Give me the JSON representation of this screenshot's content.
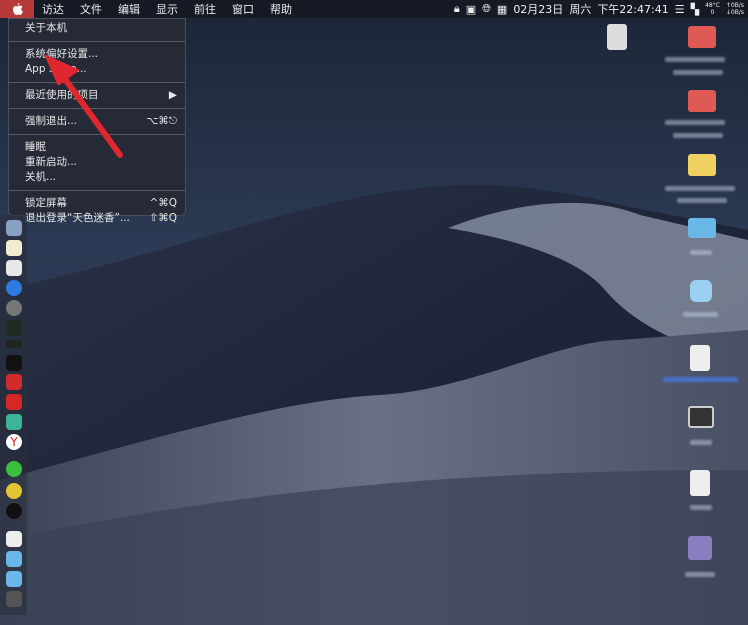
{
  "menubar": {
    "apple": "",
    "items": [
      "访达",
      "文件",
      "编辑",
      "显示",
      "前往",
      "窗口",
      "帮助"
    ],
    "status": {
      "date": "02月23日",
      "weekday": "周六",
      "time": "下午22:47:41",
      "temp": "48°C",
      "temp_sub": "0",
      "net_up": "↑0B/s",
      "net_down": "↓0B/s"
    }
  },
  "apple_menu": {
    "about": "关于本机",
    "prefs": "系统偏好设置...",
    "appstore": "App Store...",
    "recent": "最近使用的项目",
    "recent_arrow": "▶",
    "force_quit": "强制退出...",
    "force_quit_shortcut": "⌥⌘⎋",
    "sleep": "睡眠",
    "restart": "重新启动...",
    "shutdown": "关机...",
    "lock": "锁定屏幕",
    "lock_shortcut": "^⌘Q",
    "logout": "退出登录“天色迷香”...",
    "logout_shortcut": "⇧⌘Q"
  },
  "colors": {
    "arrow": "#e0262e",
    "apple_bg": "#b63a3a"
  }
}
